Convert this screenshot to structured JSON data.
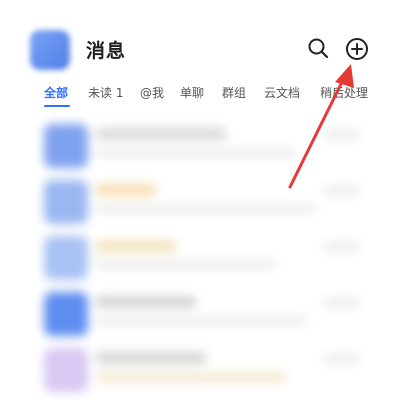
{
  "header": {
    "title": "消息",
    "search_icon": "search-icon",
    "add_icon": "add-circle-icon"
  },
  "tabs": [
    {
      "label": "全部",
      "active": true
    },
    {
      "label": "未读 1",
      "active": false
    },
    {
      "label": "@我",
      "active": false
    },
    {
      "label": "单聊",
      "active": false
    },
    {
      "label": "群组",
      "active": false
    },
    {
      "label": "云文档",
      "active": false
    },
    {
      "label": "稍后处理",
      "active": false
    }
  ],
  "colors": {
    "accent": "#3370ff",
    "annotation_arrow": "#e53935",
    "title_text": "#1f1f1f",
    "tab_text": "#555555"
  }
}
